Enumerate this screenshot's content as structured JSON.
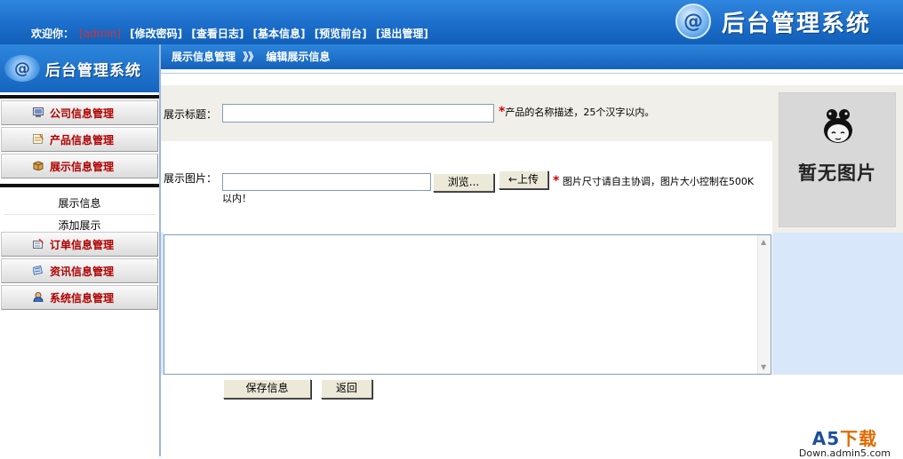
{
  "header": {
    "welcome": "欢迎你：",
    "user": "[admin]",
    "links": [
      "[修改密码]",
      "[查看日志]",
      "[基本信息]",
      "[预览前台]",
      "[退出管理]"
    ],
    "logo_text": "@",
    "system_title": "后台管理系统"
  },
  "sidebar": {
    "logo_text": "@",
    "title": "后台管理系统",
    "menu_top": [
      {
        "label": "公司信息管理",
        "icon": "computer-icon"
      },
      {
        "label": "产品信息管理",
        "icon": "notepad-icon"
      },
      {
        "label": "展示信息管理",
        "icon": "box-icon"
      }
    ],
    "submenu": [
      "展示信息",
      "添加展示"
    ],
    "menu_bottom": [
      {
        "label": "订单信息管理",
        "icon": "order-icon"
      },
      {
        "label": "资讯信息管理",
        "icon": "news-icon"
      },
      {
        "label": "系统信息管理",
        "icon": "user-icon"
      }
    ]
  },
  "breadcrumb": {
    "section": "展示信息管理",
    "separator": "》》",
    "page": "编辑展示信息"
  },
  "form": {
    "title_label": "展示标题：",
    "title_value": "",
    "required_mark": "*",
    "title_hint": "产品的名称描述，25个汉字以内。",
    "image_label": "展示图片：",
    "image_value": "",
    "browse_label": "浏览...",
    "upload_label": "←上传",
    "image_hint": "图片尺寸请自主协调，图片大小控制在500K",
    "image_hint_cont": "以内！",
    "content_value": "",
    "no_image_text": "暂无图片",
    "save_label": "保存信息",
    "back_label": "返回"
  },
  "watermark": {
    "brand": "A5",
    "brand_suffix": "下载",
    "site": "Down.admin5.com"
  },
  "colors": {
    "header_blue": "#1a6cc8",
    "menu_red": "#b00000",
    "required_red": "#d00000",
    "panel_gray": "#f0efe9",
    "panel_blue": "#d8e8fa"
  }
}
